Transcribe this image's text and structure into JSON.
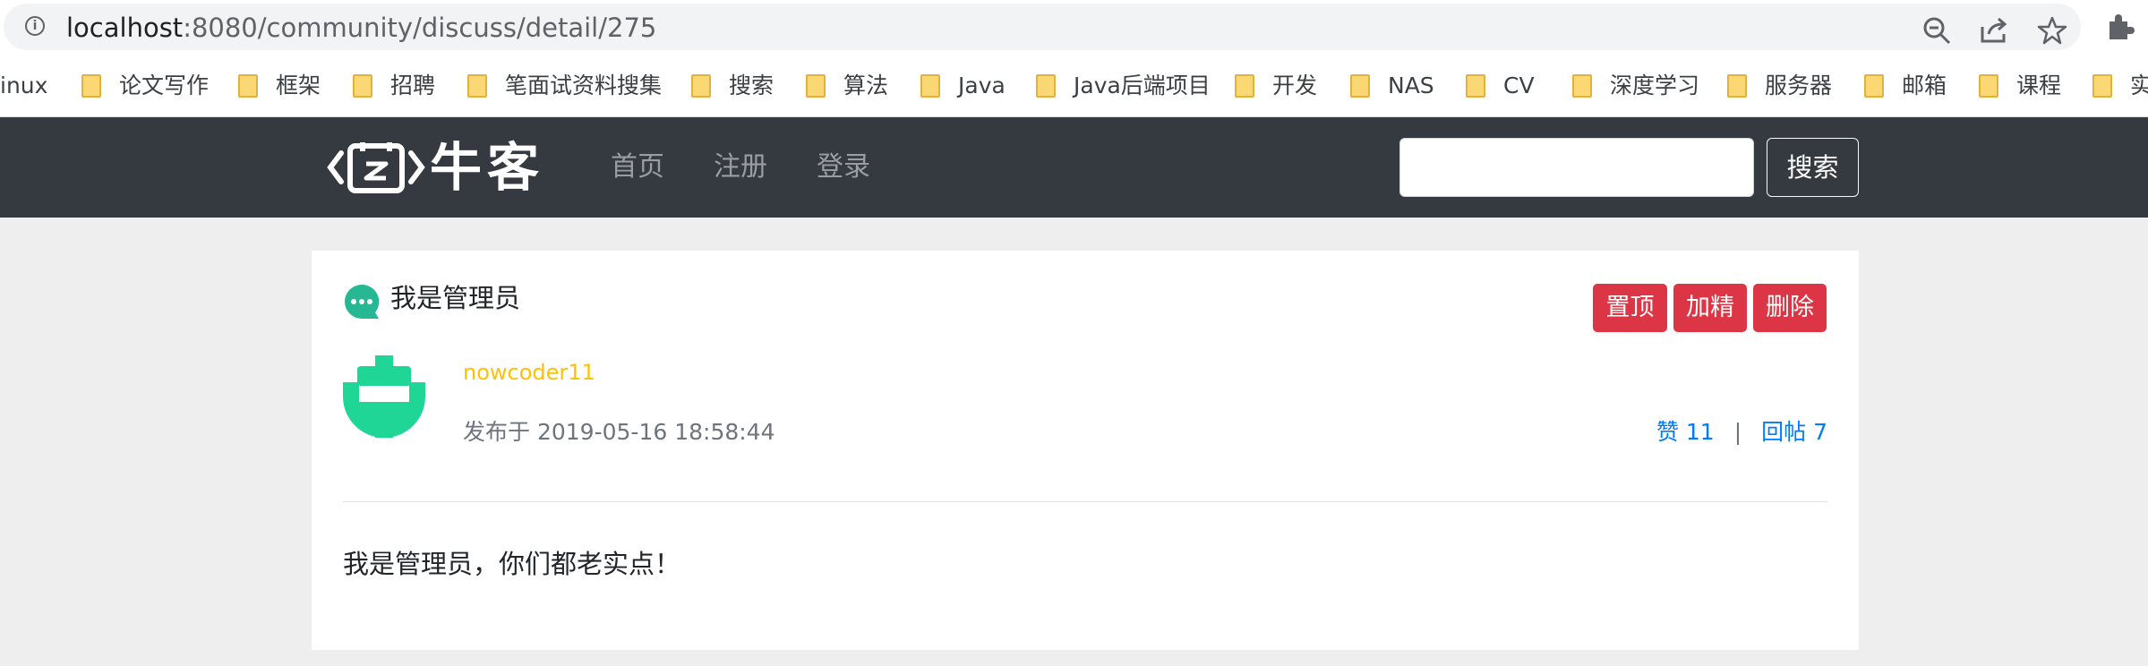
{
  "browser": {
    "url_host": "localhost",
    "url_rest": ":8080/community/discuss/detail/275"
  },
  "bookmarks": [
    {
      "label": "inux",
      "folder": false
    },
    {
      "label": "论文写作",
      "folder": true
    },
    {
      "label": "框架",
      "folder": true
    },
    {
      "label": "招聘",
      "folder": true
    },
    {
      "label": "笔面试资料搜集",
      "folder": true
    },
    {
      "label": "搜索",
      "folder": true
    },
    {
      "label": "算法",
      "folder": true
    },
    {
      "label": "Java",
      "folder": true
    },
    {
      "label": "Java后端项目",
      "folder": true
    },
    {
      "label": "开发",
      "folder": true
    },
    {
      "label": "NAS",
      "folder": true
    },
    {
      "label": "CV",
      "folder": true
    },
    {
      "label": "深度学习",
      "folder": true
    },
    {
      "label": "服务器",
      "folder": true
    },
    {
      "label": "邮箱",
      "folder": true
    },
    {
      "label": "课程",
      "folder": true
    },
    {
      "label": "实",
      "folder": true
    }
  ],
  "navbar": {
    "brand": "牛客",
    "links": [
      "首页",
      "注册",
      "登录"
    ],
    "search_button": "搜索"
  },
  "post": {
    "title": "我是管理员",
    "actions": [
      "置顶",
      "加精",
      "删除"
    ],
    "author": "nowcoder11",
    "posted_prefix": "发布于",
    "posted_time": "2019-05-16 18:58:44",
    "likes_label": "赞 11",
    "separator": "|",
    "replies_label": "回帖 7",
    "content": "我是管理员，你们都老实点！"
  },
  "colors": {
    "navbar_bg": "#343a40",
    "danger": "#dc3545",
    "author": "#ffc107",
    "link": "#007bff",
    "avatar": "#1fd697"
  }
}
